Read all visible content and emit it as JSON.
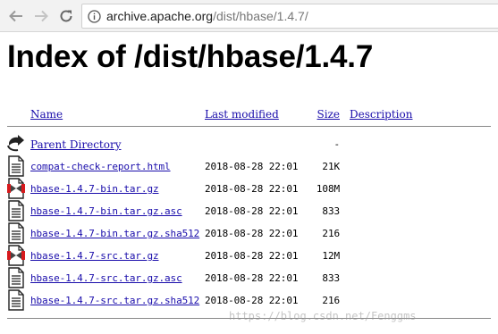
{
  "browser": {
    "url_host": "archive.apache.org",
    "url_path": "/dist/hbase/1.4.7/"
  },
  "page": {
    "title": "Index of /dist/hbase/1.4.7"
  },
  "table": {
    "headers": {
      "name": "Name",
      "last_modified": "Last modified",
      "size": "Size",
      "description": "Description"
    },
    "rows": [
      {
        "icon": "back-icon",
        "name": "Parent Directory",
        "modified": "",
        "size": "-"
      },
      {
        "icon": "text-file-icon",
        "name": "compat-check-report.html",
        "modified": "2018-08-28 22:01",
        "size": "21K"
      },
      {
        "icon": "binary-file-icon",
        "name": "hbase-1.4.7-bin.tar.gz",
        "modified": "2018-08-28 22:01",
        "size": "108M"
      },
      {
        "icon": "text-file-icon",
        "name": "hbase-1.4.7-bin.tar.gz.asc",
        "modified": "2018-08-28 22:01",
        "size": "833"
      },
      {
        "icon": "text-file-icon",
        "name": "hbase-1.4.7-bin.tar.gz.sha512",
        "modified": "2018-08-28 22:01",
        "size": "216"
      },
      {
        "icon": "binary-file-icon",
        "name": "hbase-1.4.7-src.tar.gz",
        "modified": "2018-08-28 22:01",
        "size": "12M"
      },
      {
        "icon": "text-file-icon",
        "name": "hbase-1.4.7-src.tar.gz.asc",
        "modified": "2018-08-28 22:01",
        "size": "833"
      },
      {
        "icon": "text-file-icon",
        "name": "hbase-1.4.7-src.tar.gz.sha512",
        "modified": "2018-08-28 22:01",
        "size": "216"
      }
    ]
  },
  "watermark": "https://blog.csdn.net/Fenggms",
  "colors": {
    "link": "#1a0dab"
  }
}
